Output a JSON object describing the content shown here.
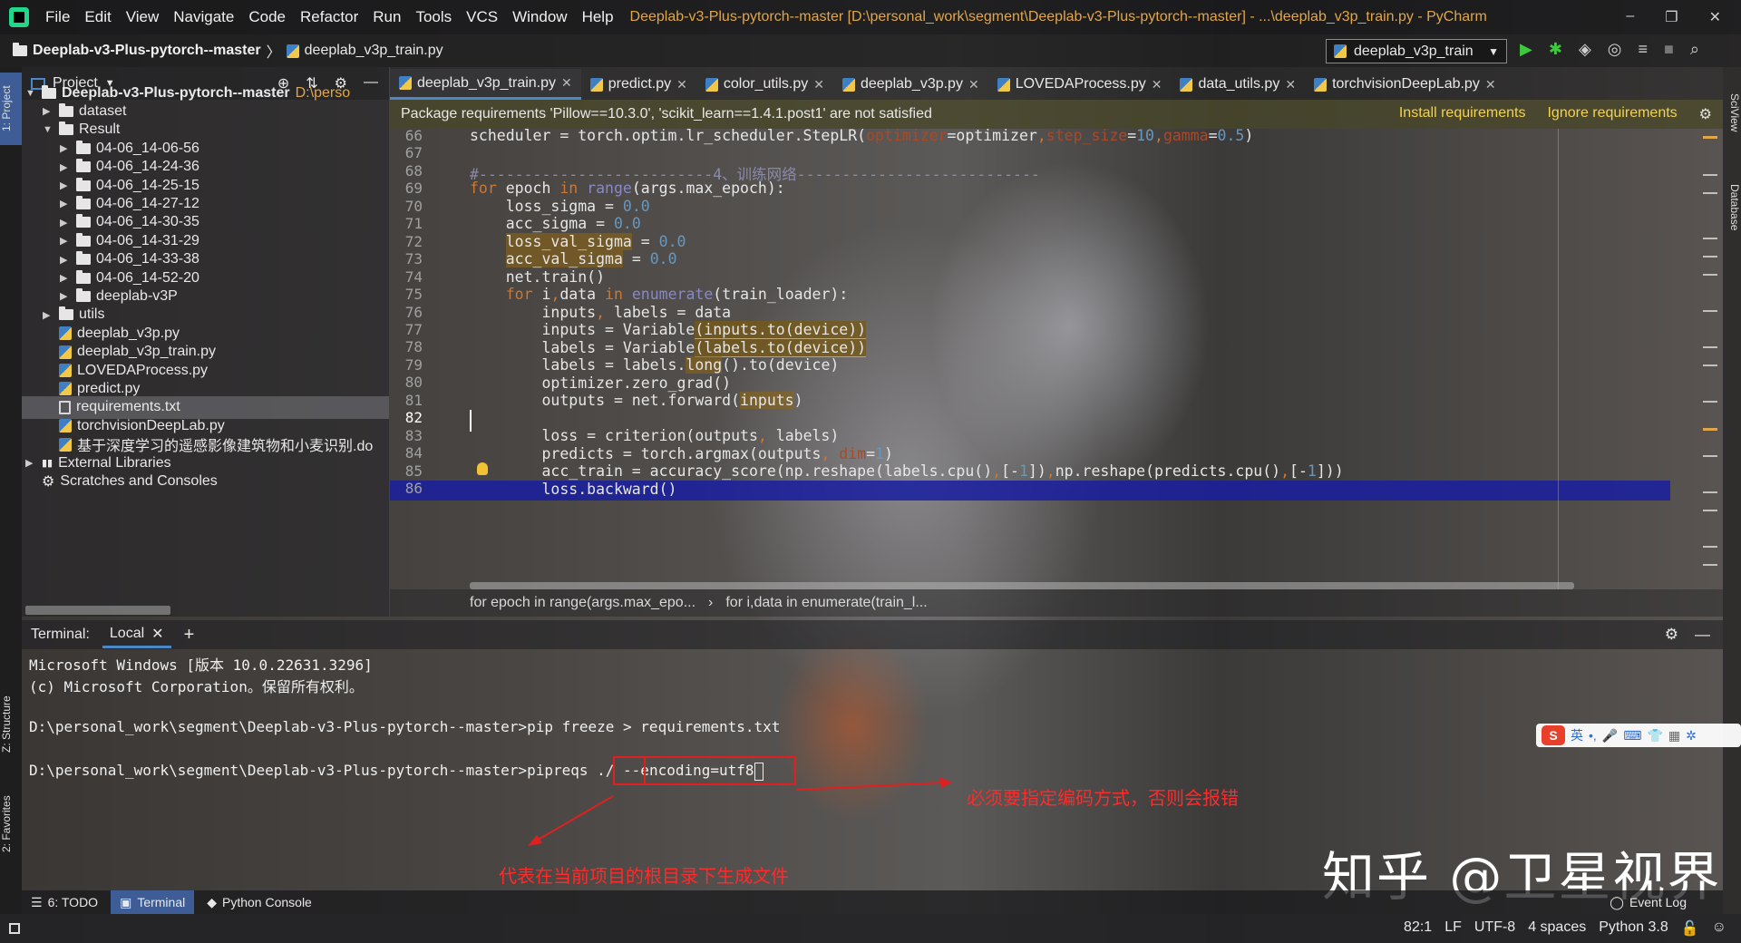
{
  "menubar": {
    "items": [
      "File",
      "Edit",
      "View",
      "Navigate",
      "Code",
      "Refactor",
      "Run",
      "Tools",
      "VCS",
      "Window",
      "Help"
    ],
    "title": "Deeplab-v3-Plus-pytorch--master [D:\\personal_work\\segment\\Deeplab-v3-Plus-pytorch--master] - ...\\deeplab_v3p_train.py - PyCharm",
    "window_buttons": [
      "–",
      "❐",
      "✕"
    ]
  },
  "navbar": {
    "project": "Deeplab-v3-Plus-pytorch--master",
    "separator": "〉",
    "file": "deeplab_v3p_train.py",
    "run_config": "deeplab_v3p_train"
  },
  "left_strip": {
    "project_tab": "1: Project",
    "structure_tab": "Z: Structure",
    "favorites_tab": "2: Favorites"
  },
  "right_strip": {
    "sciview_tab": "SciView",
    "database_tab": "Database"
  },
  "project_panel": {
    "title": "Project",
    "tree": [
      {
        "label": "Deeplab-v3-Plus-pytorch--master",
        "path": "D:\\perso",
        "type": "folder",
        "depth": 0,
        "expanded": true
      },
      {
        "label": "dataset",
        "type": "folder",
        "depth": 1,
        "expanded": false
      },
      {
        "label": "Result",
        "type": "folder",
        "depth": 1,
        "expanded": true
      },
      {
        "label": "04-06_14-06-56",
        "type": "folder",
        "depth": 2,
        "expanded": false
      },
      {
        "label": "04-06_14-24-36",
        "type": "folder",
        "depth": 2,
        "expanded": false
      },
      {
        "label": "04-06_14-25-15",
        "type": "folder",
        "depth": 2,
        "expanded": false
      },
      {
        "label": "04-06_14-27-12",
        "type": "folder",
        "depth": 2,
        "expanded": false
      },
      {
        "label": "04-06_14-30-35",
        "type": "folder",
        "depth": 2,
        "expanded": false
      },
      {
        "label": "04-06_14-31-29",
        "type": "folder",
        "depth": 2,
        "expanded": false
      },
      {
        "label": "04-06_14-33-38",
        "type": "folder",
        "depth": 2,
        "expanded": false
      },
      {
        "label": "04-06_14-52-20",
        "type": "folder",
        "depth": 2,
        "expanded": false
      },
      {
        "label": "deeplab-v3P",
        "type": "folder",
        "depth": 2,
        "expanded": false
      },
      {
        "label": "utils",
        "type": "folder",
        "depth": 1,
        "expanded": false
      },
      {
        "label": "deeplab_v3p.py",
        "type": "py",
        "depth": 1
      },
      {
        "label": "deeplab_v3p_train.py",
        "type": "py",
        "depth": 1
      },
      {
        "label": "LOVEDAProcess.py",
        "type": "py",
        "depth": 1
      },
      {
        "label": "predict.py",
        "type": "py",
        "depth": 1
      },
      {
        "label": "requirements.txt",
        "type": "txt",
        "depth": 1,
        "selected": true
      },
      {
        "label": "torchvisionDeepLab.py",
        "type": "py",
        "depth": 1
      },
      {
        "label": "基于深度学习的遥感影像建筑物和小麦识别.do",
        "type": "py",
        "depth": 1
      },
      {
        "label": "External Libraries",
        "type": "lib",
        "depth": 0,
        "expanded": false
      },
      {
        "label": "Scratches and Consoles",
        "type": "scratch",
        "depth": 0
      }
    ]
  },
  "editor_tabs": [
    {
      "label": "deeplab_v3p_train.py",
      "active": true
    },
    {
      "label": "predict.py"
    },
    {
      "label": "color_utils.py"
    },
    {
      "label": "deeplab_v3p.py"
    },
    {
      "label": "LOVEDAProcess.py"
    },
    {
      "label": "data_utils.py"
    },
    {
      "label": "torchvisionDeepLab.py"
    }
  ],
  "banner": {
    "message": "Package requirements 'Pillow==10.3.0', 'scikit_learn==1.4.1.post1' are not satisfied",
    "install": "Install requirements",
    "ignore": "Ignore requirements"
  },
  "editor": {
    "line_numbers": [
      "66",
      "67",
      "68",
      "69",
      "70",
      "71",
      "72",
      "73",
      "74",
      "75",
      "76",
      "77",
      "78",
      "79",
      "80",
      "81",
      "82",
      "83",
      "84",
      "85",
      "86"
    ],
    "current_line": "82",
    "breadcrumbs": [
      "for epoch in range(args.max_epo...",
      "for i,data in enumerate(train_l..."
    ]
  },
  "terminal": {
    "label": "Terminal:",
    "tab": "Local",
    "lines": [
      "Microsoft Windows [版本 10.0.22631.3296]",
      "(c) Microsoft Corporation。保留所有权利。",
      "",
      "D:\\personal_work\\segment\\Deeplab-v3-Plus-pytorch--master>pip freeze > requirements.txt",
      ""
    ],
    "prompt": "D:\\personal_work\\segment\\Deeplab-v3-Plus-pytorch--master>pipreqs ",
    "arg": "./",
    "rest": " --encoding=utf8"
  },
  "annotations": {
    "encoding_note": "必须要指定编码方式，否则会报错",
    "root_note": "代表在当前项目的根目录下生成文件"
  },
  "ime": {
    "lang": "英"
  },
  "watermark": "知乎 @卫星视界",
  "bottom_tabs": [
    {
      "label": "6: TODO"
    },
    {
      "label": "Terminal",
      "active": true
    },
    {
      "label": "Python Console"
    }
  ],
  "event_log": "Event Log",
  "status": {
    "position": "82:1",
    "line_sep": "LF",
    "encoding": "UTF-8",
    "indent": "4 spaces",
    "interpreter": "Python 3.8"
  }
}
